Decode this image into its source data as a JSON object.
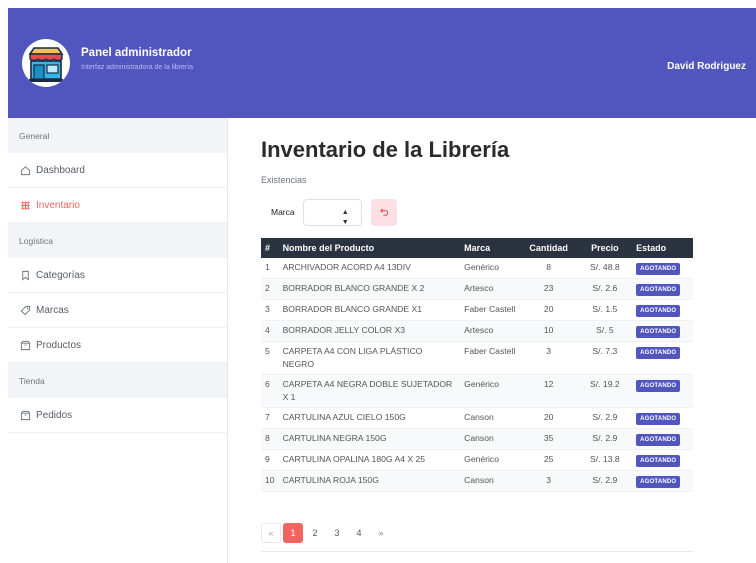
{
  "header": {
    "title": "Panel administrador",
    "subtitle": "Interfaz administradora de la librería",
    "user": "David Rodriguez"
  },
  "sidebar": {
    "sections": [
      {
        "label": "General"
      },
      {
        "label": "Logística"
      },
      {
        "label": "Tienda"
      }
    ],
    "items": [
      {
        "label": "Dashboard",
        "icon": "home-icon"
      },
      {
        "label": "Inventario",
        "icon": "inventory-icon",
        "active": true
      },
      {
        "label": "Categorías",
        "icon": "bookmark-icon"
      },
      {
        "label": "Marcas",
        "icon": "tag-icon"
      },
      {
        "label": "Productos",
        "icon": "box-icon"
      },
      {
        "label": "Pedidos",
        "icon": "box-icon"
      }
    ]
  },
  "main": {
    "title": "Inventario de la Librería",
    "subtitle": "Existencias",
    "filter": {
      "label": "Marca",
      "value": ""
    },
    "table": {
      "headers": [
        "#",
        "Nombre del Producto",
        "Marca",
        "Cantidad",
        "Precio",
        "Estado"
      ],
      "rows": [
        [
          "1",
          "ARCHIVADOR ACORD A4 13DIV",
          "Genérico",
          "8",
          "S/. 48.8",
          "AGOTANDO"
        ],
        [
          "2",
          "BORRADOR BLANCO GRANDE X 2",
          "Artesco",
          "23",
          "S/. 2.6",
          "AGOTANDO"
        ],
        [
          "3",
          "BORRADOR BLANCO GRANDE X1",
          "Faber Castell",
          "20",
          "S/. 1.5",
          "AGOTANDO"
        ],
        [
          "4",
          "BORRADOR JELLY COLOR X3",
          "Artesco",
          "10",
          "S/. 5",
          "AGOTANDO"
        ],
        [
          "5",
          "CARPETA A4 CON LIGA PLÁSTICO NEGRO",
          "Faber Castell",
          "3",
          "S/. 7.3",
          "AGOTANDO"
        ],
        [
          "6",
          "CARPETA A4 NEGRA DOBLE SUJETADOR X 1",
          "Genérico",
          "12",
          "S/. 19.2",
          "AGOTANDO"
        ],
        [
          "7",
          "CARTULINA AZUL CIELO 150G",
          "Canson",
          "20",
          "S/. 2.9",
          "AGOTANDO"
        ],
        [
          "8",
          "CARTULINA NEGRA 150G",
          "Canson",
          "35",
          "S/. 2.9",
          "AGOTANDO"
        ],
        [
          "9",
          "CARTULINA OPALINA 180G A4 X 25",
          "Genérico",
          "25",
          "S/. 13.8",
          "AGOTANDO"
        ],
        [
          "10",
          "CARTULINA ROJA 150G",
          "Canson",
          "3",
          "S/. 2.9",
          "AGOTANDO"
        ]
      ]
    },
    "pagination": {
      "first": "«",
      "pages": [
        "1",
        "2",
        "3",
        "4"
      ],
      "current": "1",
      "last": "»"
    }
  },
  "colors": {
    "header_bg": "#5156be",
    "accent": "#f26461",
    "badge": "#5156be",
    "table_head": "#2c3340"
  }
}
